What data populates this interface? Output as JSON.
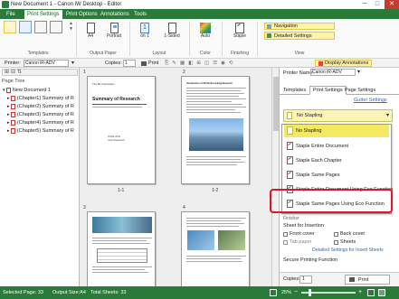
{
  "window": {
    "title": "New Document 1 - Canon iW Desktop - Editor",
    "minimize": "─",
    "maximize": "□",
    "close": "✕"
  },
  "menu": {
    "tabs": [
      "File",
      "Print Settings",
      "Print Options",
      "Annotations",
      "Tools"
    ]
  },
  "ribbon": {
    "group_templates": "Templates",
    "btn_a4": "A4",
    "btn_portrait": "Portrait",
    "group_output_paper": "Output Paper",
    "btn_one_on": "1",
    "btn_one_on_sub": "on 1",
    "btn_one_sided": "1-Sided",
    "group_layout": "Layout",
    "btn_auto": "Auto",
    "group_color": "Color",
    "btn_staple": "Staple",
    "group_finishing": "Finishing",
    "btn_navigation": "Navigation",
    "btn_detailed": "Detailed Settings",
    "group_view": "View"
  },
  "toolbar": {
    "printer_label": "Printer:",
    "printer_value": "Canon iR-ADV",
    "copies_label": "Copies:",
    "copies_value": "1",
    "print_label": "Print",
    "display_annotations": "Display Annotations"
  },
  "left": {
    "heading": "Page Tree",
    "items": [
      "New Document 1",
      "(Chapter1) Summary of R",
      "(Chapter2) Summary of R",
      "(Chapter3) Summary of R",
      "(Chapter4) Summary of R",
      "(Chapter5) Summary of R"
    ]
  },
  "center": {
    "chapter1": "1",
    "chapter2": "2",
    "chapter3": "3",
    "chapter4": "4",
    "page_11": "1-1",
    "page_12": "1-2",
    "page11_header": "The 3D Corporation",
    "page11_title": "Summary of Research",
    "page11_date": "JUNE 2011",
    "page11_sub": "Joint Research",
    "page12_header": "Introduction of 3D Ink Recording Research"
  },
  "right": {
    "printer_label": "Printer Name:",
    "printer_value": "Canon iR-ADV",
    "tabs": [
      "Templates",
      "Print Settings",
      "Page Settings"
    ],
    "link": "Gutter Settings",
    "select_value": "No Stapling",
    "options": [
      "No Stapling",
      "Staple Entire Document",
      "Staple Each Chapter",
      "Staple Same Pages",
      "Staple Entire Document Using Eco Function",
      "Staple Same Pages Using Eco Function"
    ],
    "finisher_label": "Finisher",
    "sheet_insertion": "Sheet for Insertion",
    "front_cover": "Front cover",
    "back_cover": "Back cover",
    "tab_paper": "Tab paper",
    "sheets": "Sheets",
    "detailed_link": "Detailed Settings for Insert Sheets",
    "secure": "Secure Printing Function",
    "copies_label": "Copies:",
    "copies_value": "1",
    "print_button": "Print"
  },
  "status": {
    "selected": "Selected Page: 33",
    "output_size": "Output Size:A4",
    "total": "Total Sheets: 33",
    "zoom": "25%"
  },
  "colors": {
    "brand_green": "#2a7a3a",
    "highlight_yellow": "#f3ea62",
    "callout_red": "#e0142a"
  }
}
